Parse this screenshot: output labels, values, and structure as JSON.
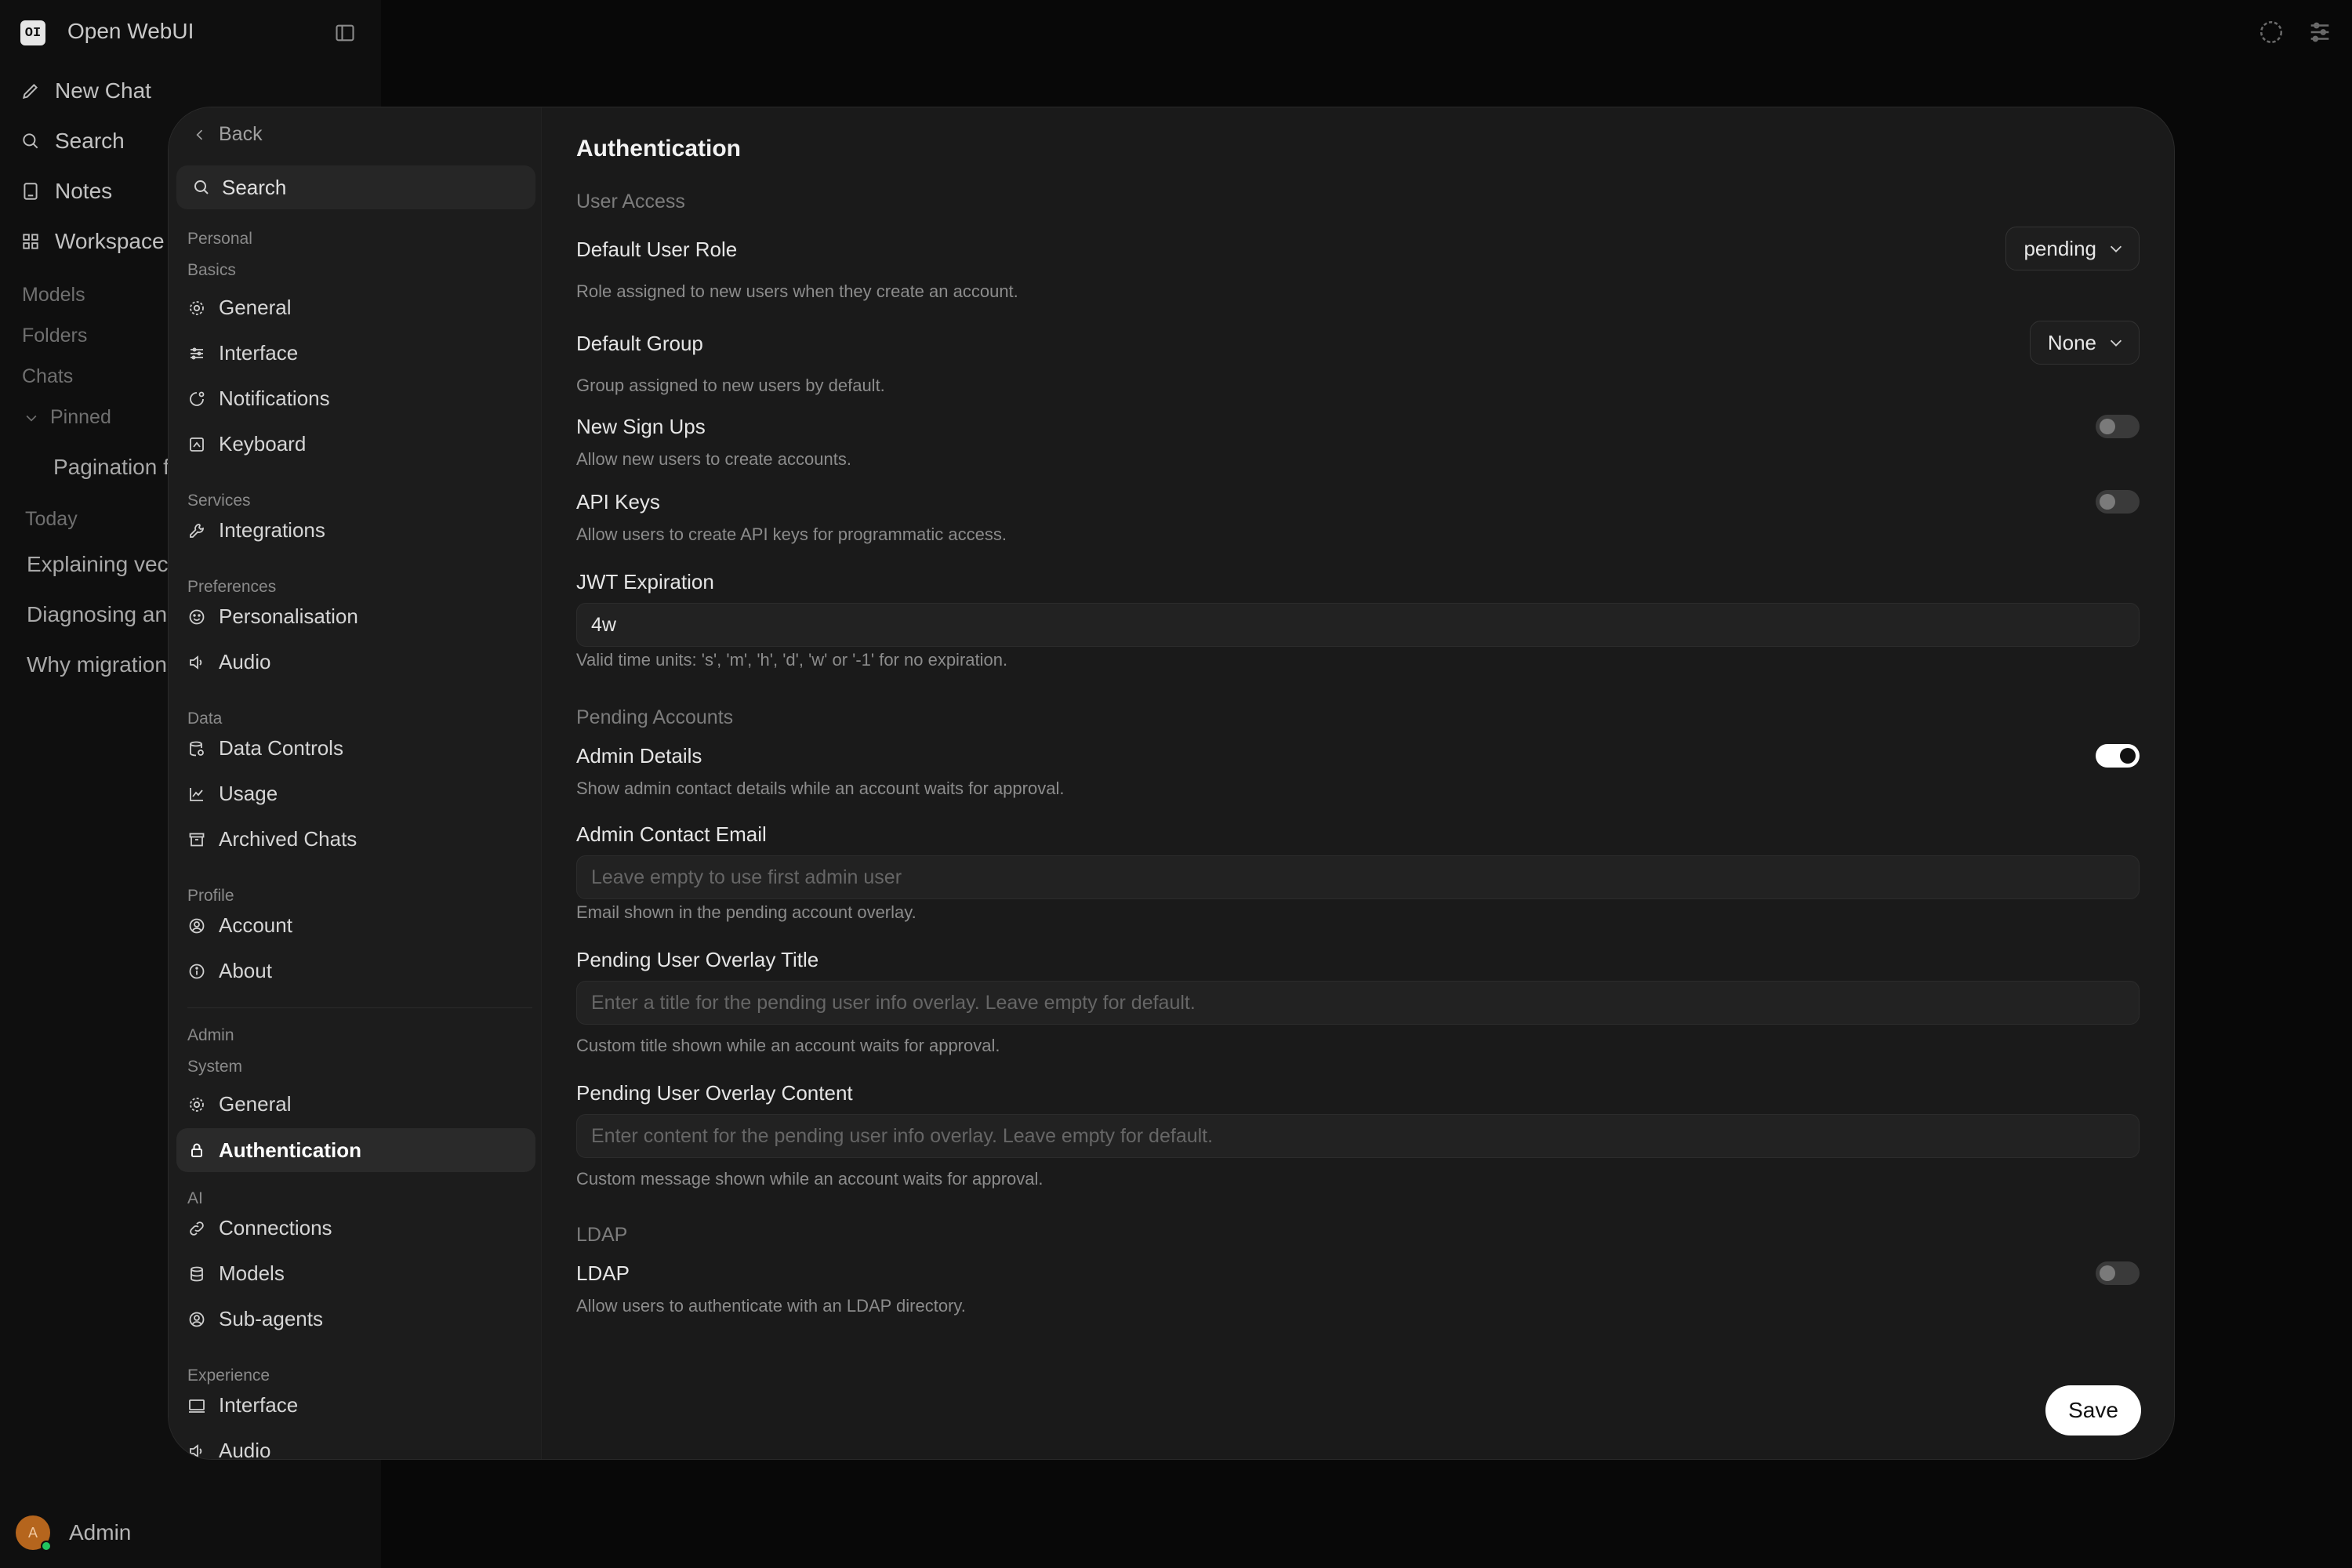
{
  "app": {
    "logo": "OI",
    "title": "Open WebUI"
  },
  "nav": {
    "new_chat": "New Chat",
    "search": "Search",
    "notes": "Notes",
    "workspace": "Workspace"
  },
  "sections": {
    "models": "Models",
    "folders": "Folders",
    "chats": "Chats",
    "pinned": "Pinned",
    "today": "Today"
  },
  "chats": {
    "pinned": [
      "Pagination f"
    ],
    "today": [
      "Explaining vect",
      "Diagnosing an",
      "Why migrations"
    ]
  },
  "user": {
    "initial": "A",
    "name": "Admin"
  },
  "modal": {
    "back": "Back",
    "search": "Search",
    "groups": {
      "personal": "Personal",
      "basics": "Basics",
      "services": "Services",
      "preferences": "Preferences",
      "data": "Data",
      "profile": "Profile",
      "admin": "Admin",
      "system": "System",
      "ai": "AI",
      "experience": "Experience"
    },
    "items": {
      "general": "General",
      "interface": "Interface",
      "notifications": "Notifications",
      "keyboard": "Keyboard",
      "integrations": "Integrations",
      "personalisation": "Personalisation",
      "audio": "Audio",
      "data_controls": "Data Controls",
      "usage": "Usage",
      "archived_chats": "Archived Chats",
      "account": "Account",
      "about": "About",
      "sys_general": "General",
      "authentication": "Authentication",
      "connections": "Connections",
      "models": "Models",
      "sub_agents": "Sub-agents",
      "exp_interface": "Interface",
      "exp_audio": "Audio"
    }
  },
  "settings": {
    "title": "Authentication",
    "user_access": "User Access",
    "default_role": {
      "label": "Default User Role",
      "value": "pending",
      "desc": "Role assigned to new users when they create an account."
    },
    "default_group": {
      "label": "Default Group",
      "value": "None",
      "desc": "Group assigned to new users by default."
    },
    "new_signups": {
      "label": "New Sign Ups",
      "desc": "Allow new users to create accounts.",
      "enabled": false
    },
    "api_keys": {
      "label": "API Keys",
      "desc": "Allow users to create API keys for programmatic access.",
      "enabled": false
    },
    "jwt": {
      "label": "JWT Expiration",
      "value": "4w",
      "desc": "Valid time units: 's', 'm', 'h', 'd', 'w' or '-1' for no expiration."
    },
    "pending_accounts": "Pending Accounts",
    "admin_details": {
      "label": "Admin Details",
      "desc": "Show admin contact details while an account waits for approval.",
      "enabled": true
    },
    "admin_email": {
      "label": "Admin Contact Email",
      "placeholder": "Leave empty to use first admin user",
      "desc": "Email shown in the pending account overlay."
    },
    "overlay_title": {
      "label": "Pending User Overlay Title",
      "placeholder": "Enter a title for the pending user info overlay. Leave empty for default.",
      "desc": "Custom title shown while an account waits for approval."
    },
    "overlay_content": {
      "label": "Pending User Overlay Content",
      "placeholder": "Enter content for the pending user info overlay. Leave empty for default.",
      "desc": "Custom message shown while an account waits for approval."
    },
    "ldap_section": "LDAP",
    "ldap": {
      "label": "LDAP",
      "desc": "Allow users to authenticate with an LDAP directory.",
      "enabled": false
    },
    "save": "Save"
  }
}
